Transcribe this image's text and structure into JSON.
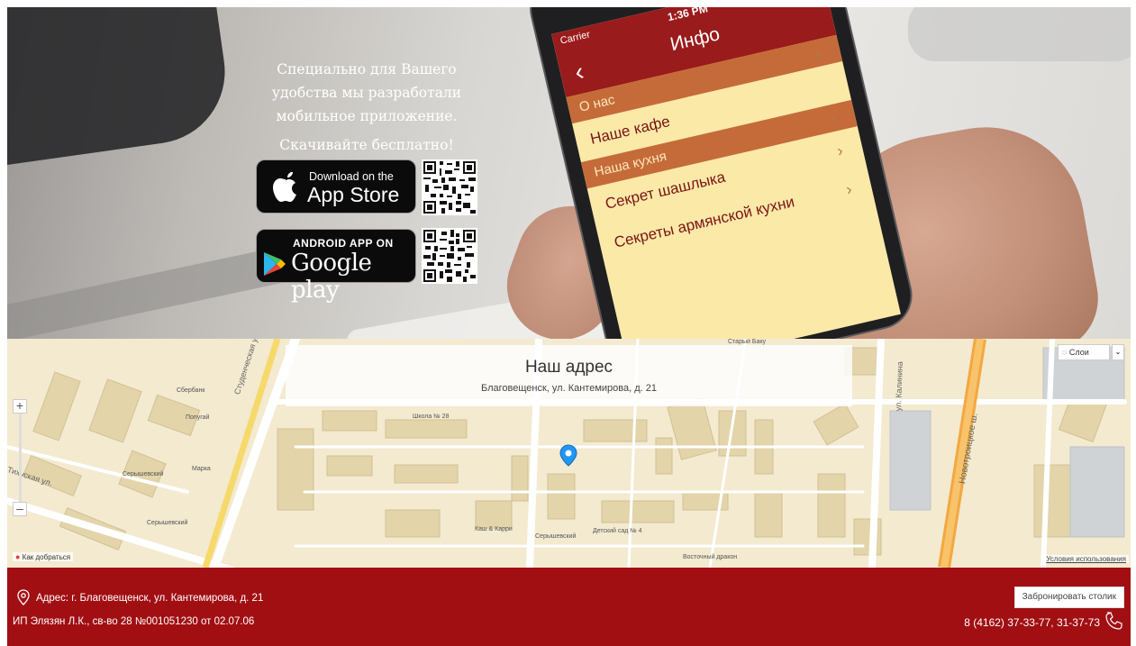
{
  "promo": {
    "line1": "Специально для Вашего",
    "line2": "удобства мы разработали",
    "line3": "мобильное приложение.",
    "line4": "Скачивайте бесплатно!",
    "appstore_small": "Download on the",
    "appstore_big": "App Store",
    "google_small": "ANDROID APP ON",
    "google_big": "Google play"
  },
  "phone": {
    "carrier": "Carrier",
    "time": "1:36 PM",
    "title": "Инфо",
    "items": [
      {
        "type": "section",
        "label": "О нас"
      },
      {
        "type": "item",
        "label": "Наше кафе"
      },
      {
        "type": "section",
        "label": "Наша кухня"
      },
      {
        "type": "item",
        "label": "Секрет шашлыка"
      },
      {
        "type": "item",
        "label": "Секреты армянской кухни"
      }
    ]
  },
  "map": {
    "title": "Наш адрес",
    "subtitle": "Благовещенск, ул. Кантемирова, д. 21",
    "layers": "Слои",
    "howto": "Как добраться",
    "terms": "Условия использования",
    "labels": [
      "Сбербанк",
      "Попугай",
      "Марка",
      "Серышевский",
      "Серышевский",
      "Школа № 28",
      "Каш & Карри",
      "Серышевский",
      "Детский сад № 4",
      "Восточный дракон",
      "Старый Баку"
    ],
    "streets": [
      "Студенческая ул.",
      "ул. Калинина",
      "Новотроицкое ш.",
      "Тихуская ул."
    ]
  },
  "footer": {
    "address": "Адрес: г. Благовещенск, ул. Кантемирова, д. 21",
    "legal": "ИП Элязян Л.К., св-во 28 №001051230 от 02.07.06",
    "book_button": "Забронировать столик",
    "phones": "8 (4162) 37-33-77, 31-37-73"
  },
  "colors": {
    "brand_red": "#a10f13",
    "app_red": "#9a1b1b",
    "app_cream": "#fbe9a8"
  }
}
